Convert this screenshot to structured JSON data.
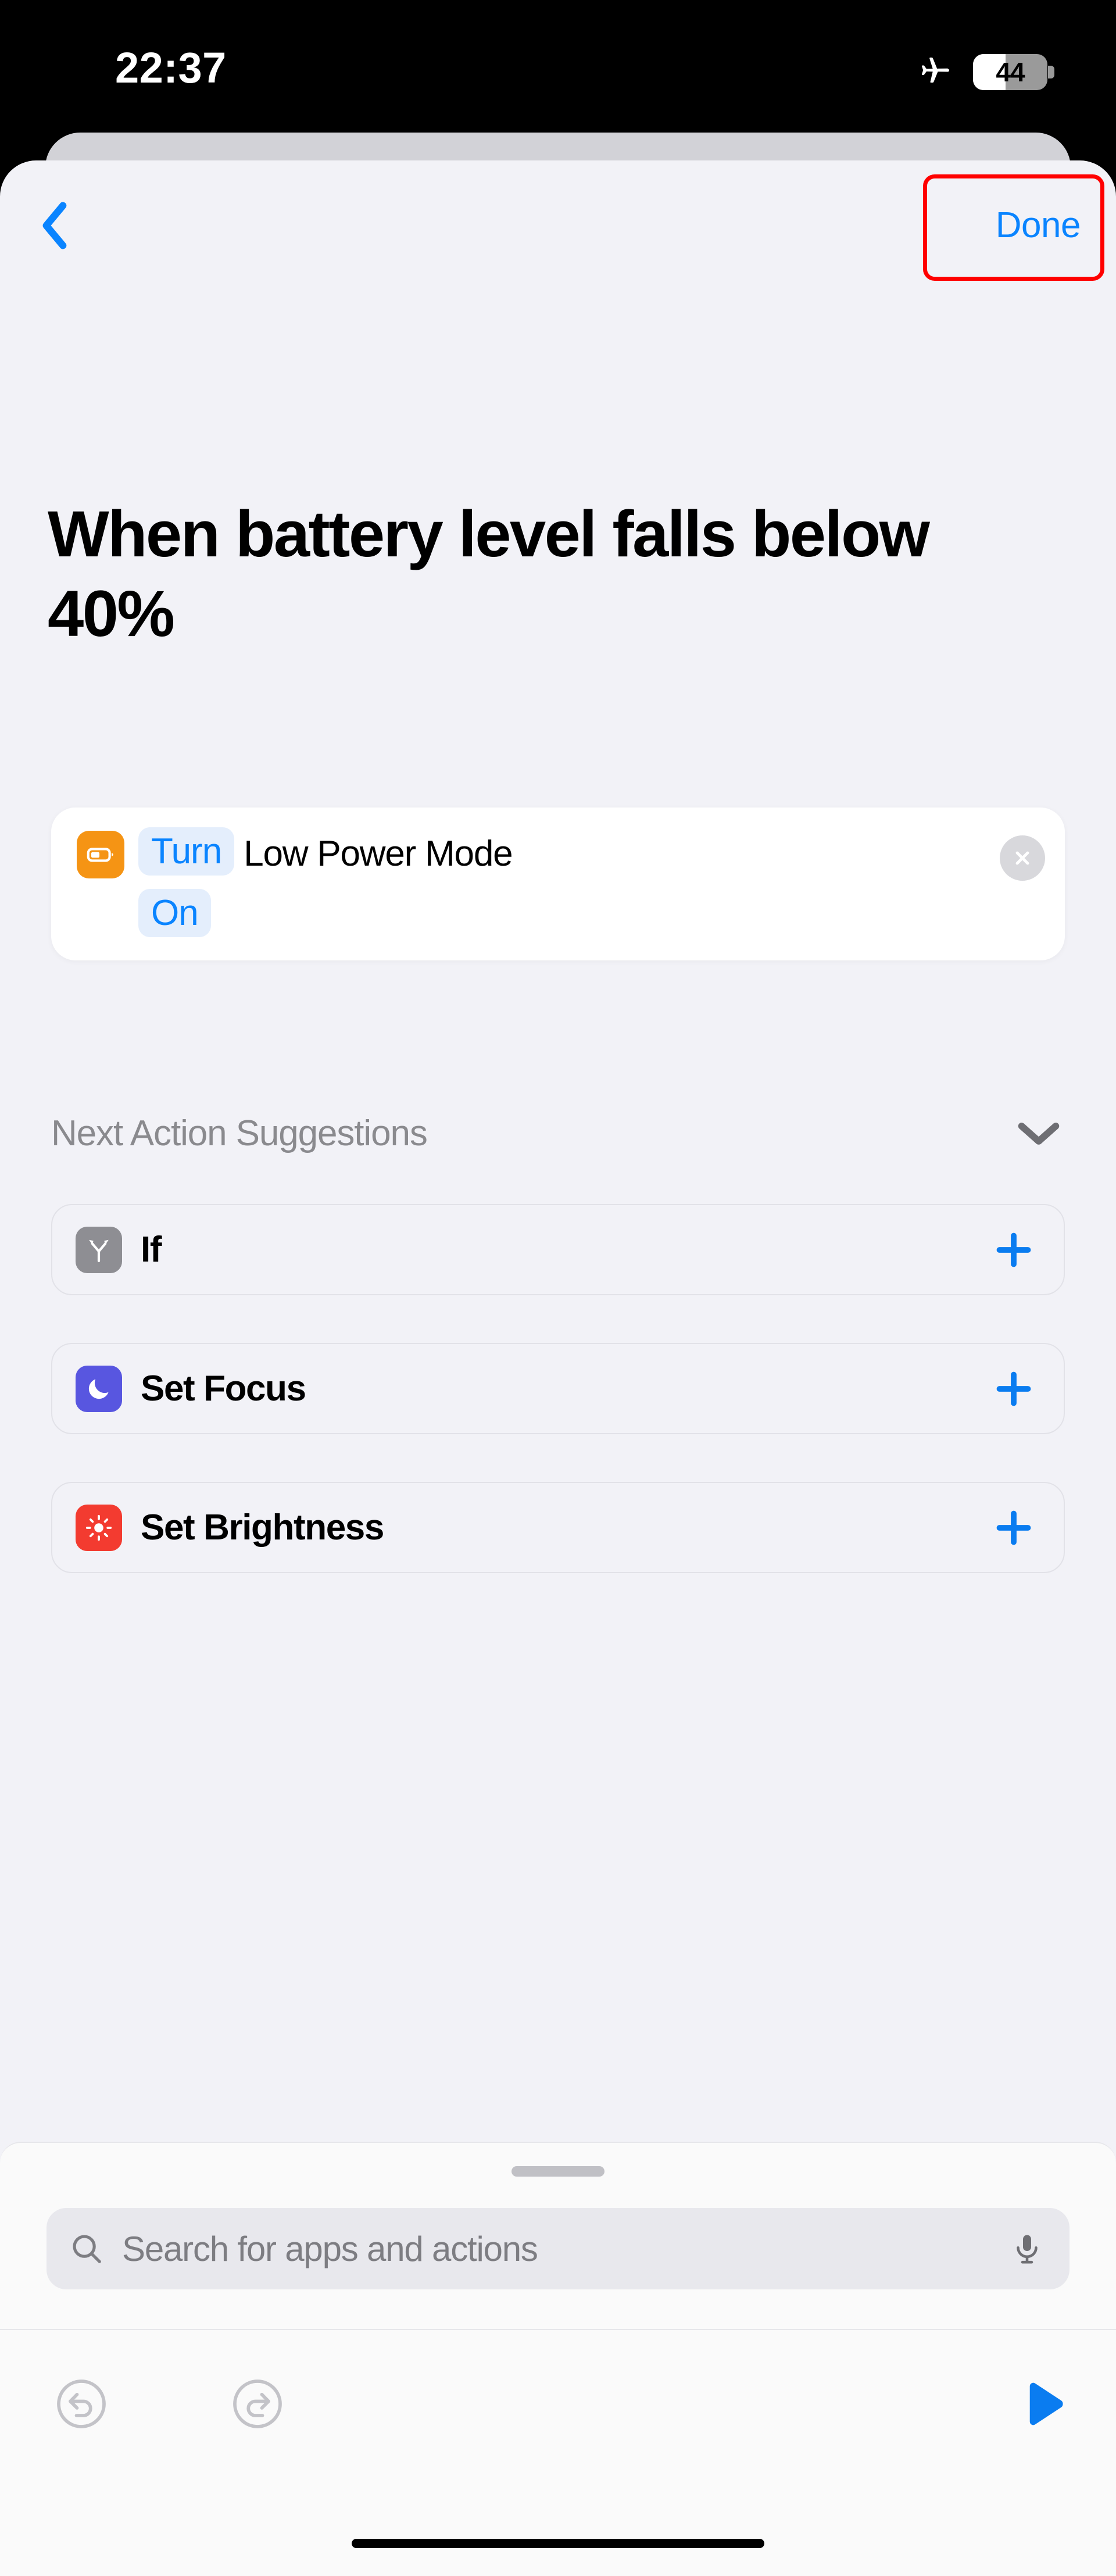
{
  "status_bar": {
    "time": "22:37",
    "airplane_icon": "airplane-icon",
    "battery_percent": "44",
    "battery_level": 44
  },
  "nav": {
    "back_icon": "chevron-left-icon",
    "done_label": "Done",
    "done_color": "#0a84ff",
    "highlight_color": "#ff0000"
  },
  "page": {
    "title": "When battery level falls below 40%"
  },
  "action": {
    "icon": "battery-icon",
    "icon_color": "#f59414",
    "token_turn": "Turn",
    "text_middle": "Low Power Mode",
    "token_state": "On",
    "token_color": "#0a84ff",
    "close_icon": "close-icon"
  },
  "suggestions": {
    "header": "Next Action Suggestions",
    "collapse_icon": "chevron-down-icon",
    "items": [
      {
        "label": "If",
        "icon": "branch-icon",
        "icon_color": "#8e8e93",
        "add_icon": "plus-icon"
      },
      {
        "label": "Set Focus",
        "icon": "moon-icon",
        "icon_color": "#5856e0",
        "add_icon": "plus-icon"
      },
      {
        "label": "Set Brightness",
        "icon": "brightness-icon",
        "icon_color": "#f33b30",
        "add_icon": "plus-icon"
      }
    ]
  },
  "search": {
    "placeholder": "Search for apps and actions",
    "search_icon": "search-icon",
    "mic_icon": "microphone-icon"
  },
  "toolbar": {
    "undo_icon": "undo-icon",
    "redo_icon": "redo-icon",
    "run_icon": "play-icon",
    "run_color": "#0a7cf0"
  }
}
